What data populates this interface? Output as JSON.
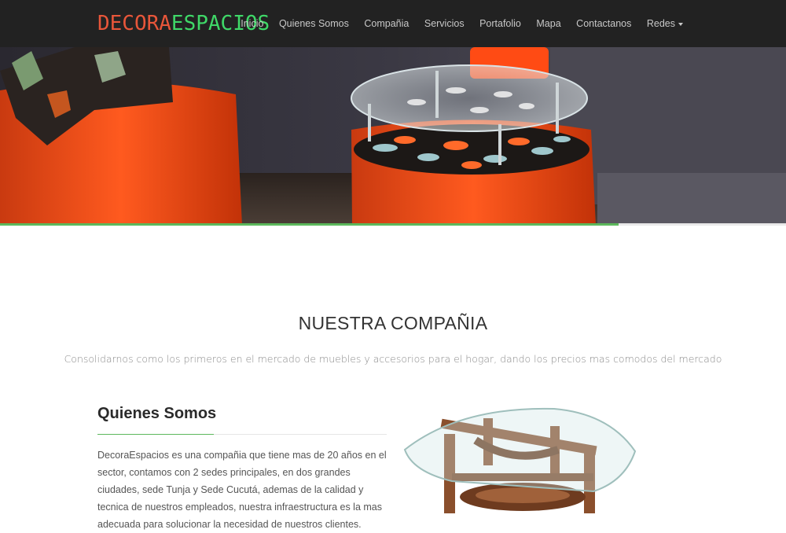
{
  "brand": {
    "part1": "DECORA",
    "part2": "ESPACIOS",
    "color1": "#e8563a",
    "color2": "#3fd868"
  },
  "nav": {
    "items": [
      {
        "label": "Inicio"
      },
      {
        "label": "Quienes Somos"
      },
      {
        "label": "Compañia"
      },
      {
        "label": "Servicios"
      },
      {
        "label": "Portafolio"
      },
      {
        "label": "Mapa"
      },
      {
        "label": "Contactanos"
      },
      {
        "label": "Redes",
        "dropdown": true
      }
    ]
  },
  "slider": {
    "progress": 0.787,
    "accent": "#5cb85c"
  },
  "company": {
    "title": "NUESTRA COMPAÑIA",
    "subtitle": "Consolidarnos como los primeros en el mercado de muebles y accesorios para el hogar, dando los precios mas comodos del mercado"
  },
  "about": {
    "title": "Quienes Somos",
    "text": "DecoraEspacios es una compañia que tiene mas de 20 años en el sector, contamos con 2 sedes principales, en dos grandes ciudades, sede Tunja y Sede Cucutá, ademas de la calidad y tecnica de nuestros empleados, nuestra infraestructura es la mas adecuada para solucionar la necesidad de nuestros clientes."
  }
}
